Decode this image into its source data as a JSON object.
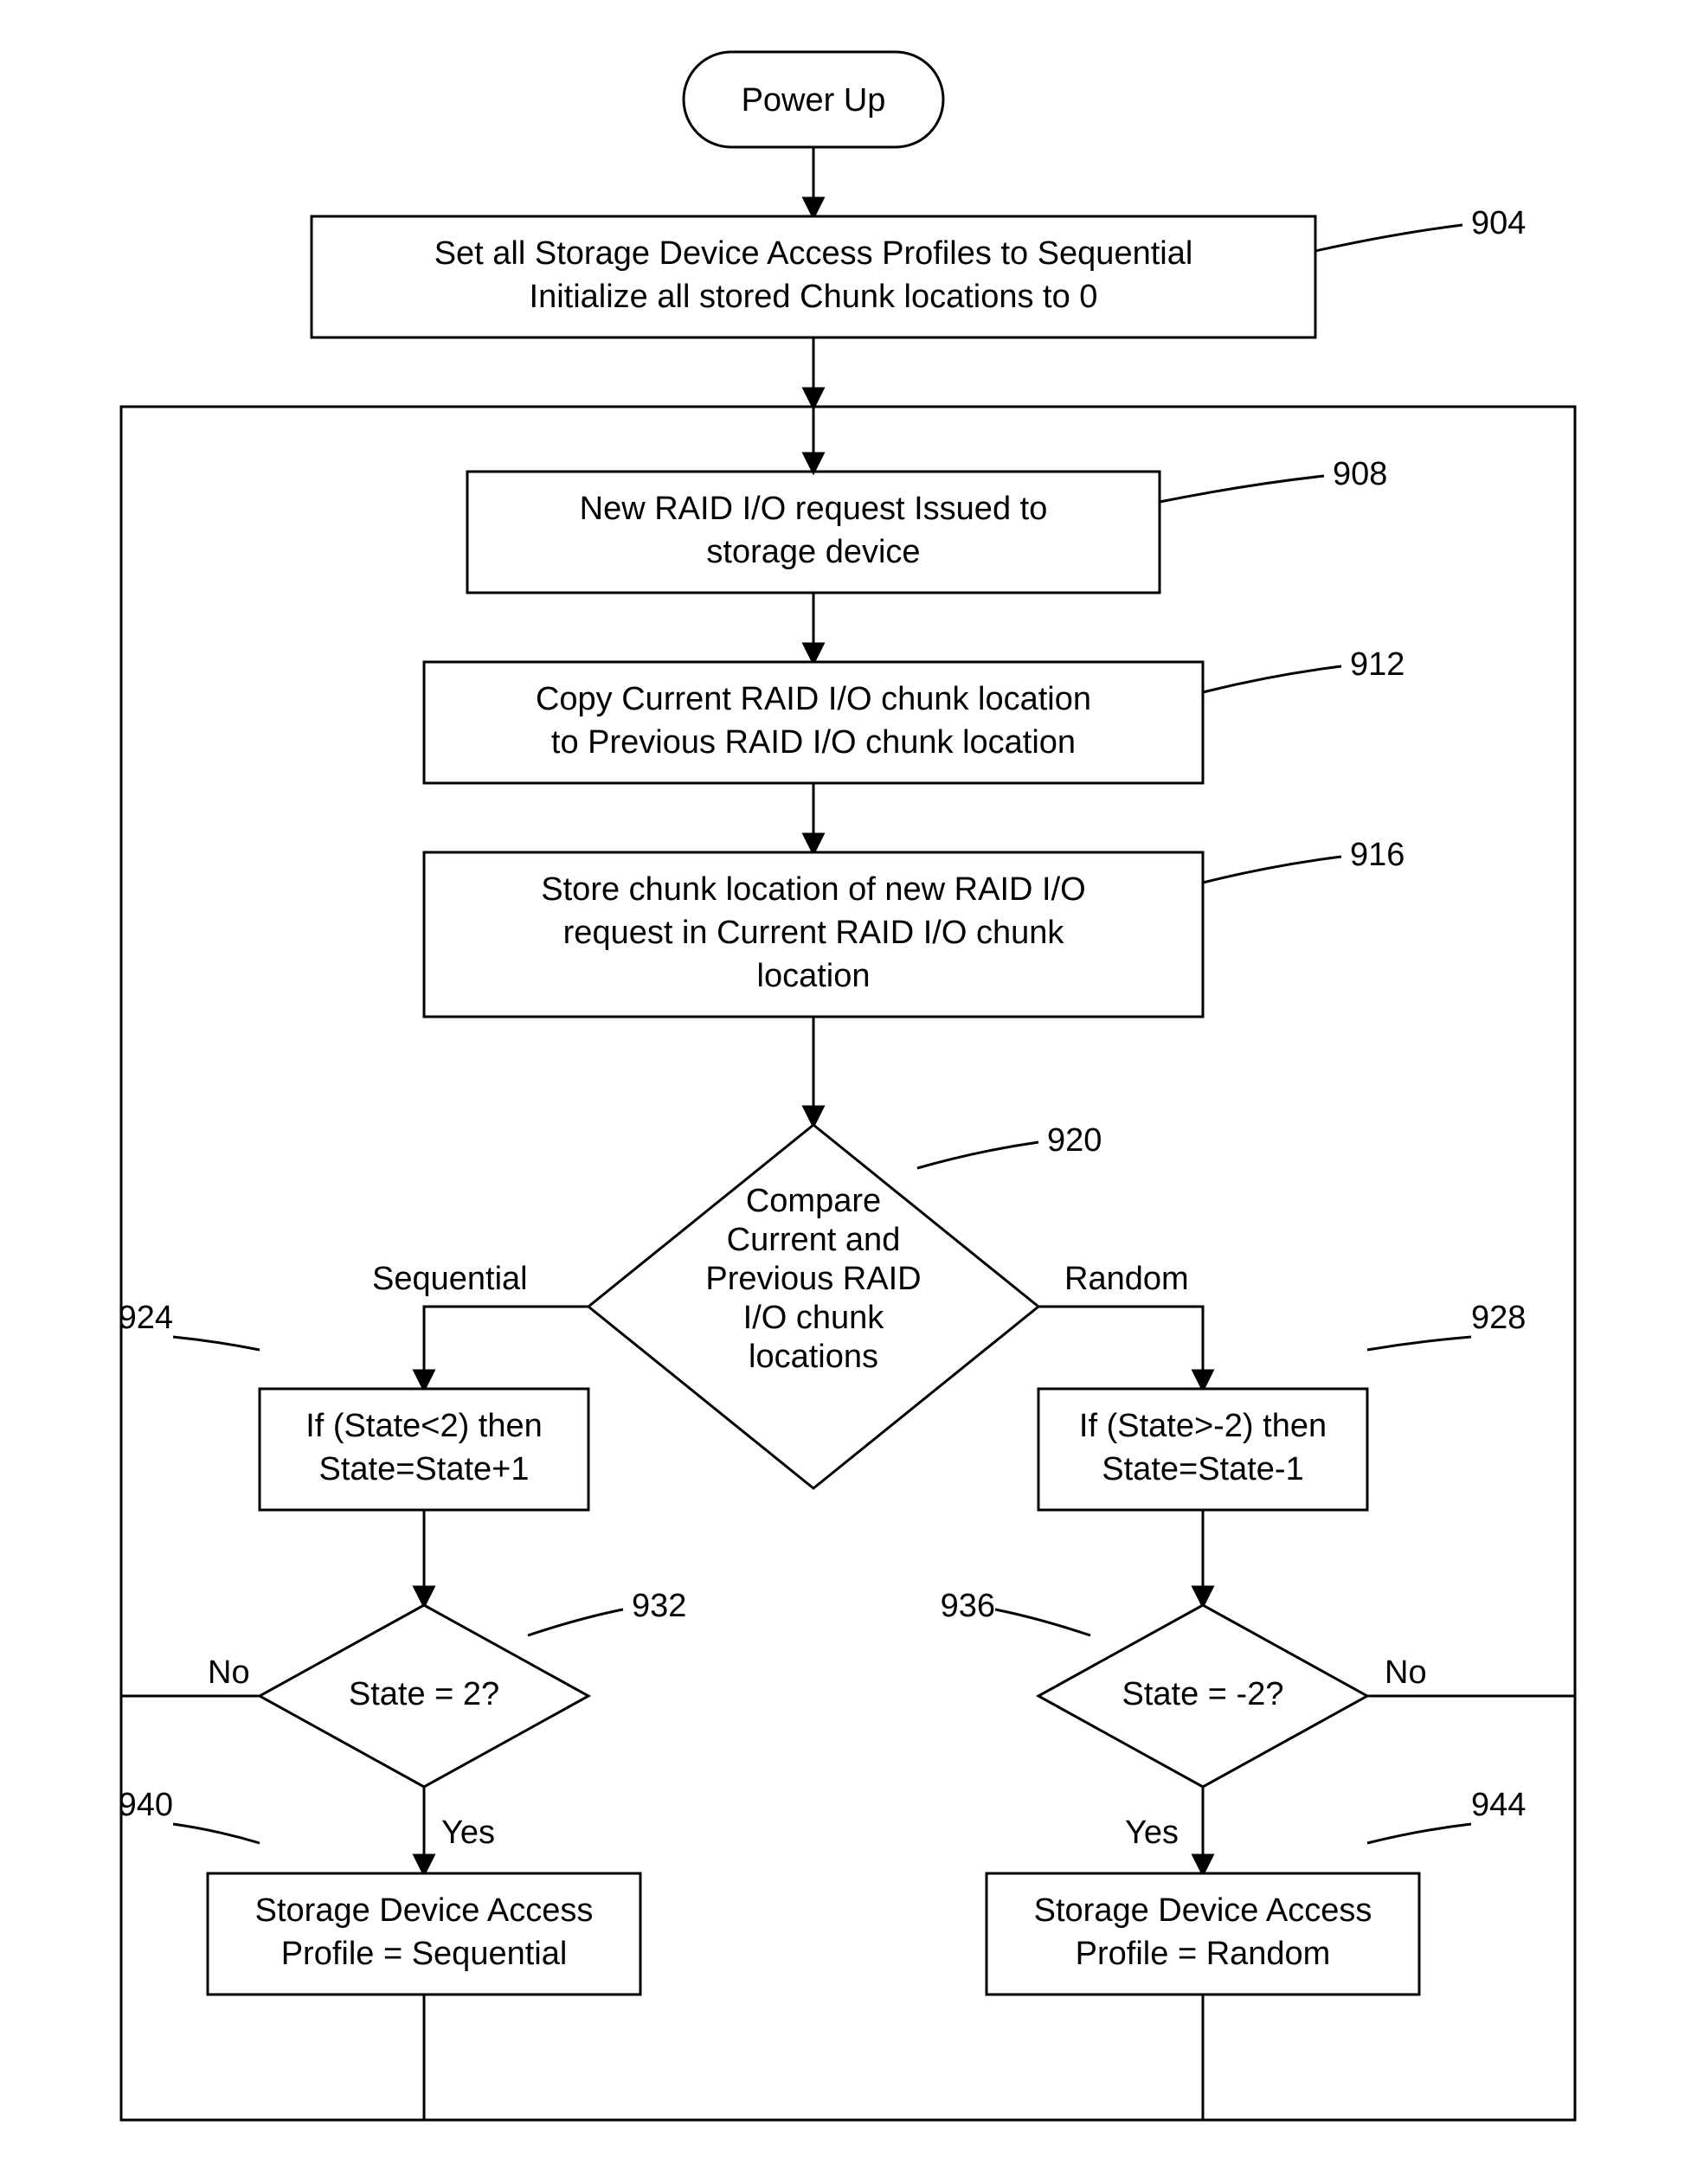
{
  "start": "Power Up",
  "n904": {
    "l1": "Set all Storage Device Access Profiles to Sequential",
    "l2": "Initialize all stored Chunk locations to 0",
    "ref": "904"
  },
  "n908": {
    "l1": "New RAID I/O request Issued to",
    "l2": "storage device",
    "ref": "908"
  },
  "n912": {
    "l1": "Copy Current RAID I/O chunk location",
    "l2": "to Previous RAID I/O chunk location",
    "ref": "912"
  },
  "n916": {
    "l1": "Store chunk location of new RAID I/O",
    "l2": "request in Current RAID I/O chunk",
    "l3": "location",
    "ref": "916"
  },
  "n920": {
    "l1": "Compare",
    "l2": "Current and",
    "l3": "Previous RAID",
    "l4": "I/O chunk",
    "l5": "locations",
    "ref": "920",
    "left": "Sequential",
    "right": "Random"
  },
  "n924": {
    "l1": "If (State<2) then",
    "l2": "State=State+1",
    "ref": "924"
  },
  "n928": {
    "l1": "If (State>-2) then",
    "l2": "State=State-1",
    "ref": "928"
  },
  "n932": {
    "l1": "State = 2?",
    "ref": "932",
    "yes": "Yes",
    "no": "No"
  },
  "n936": {
    "l1": "State = -2?",
    "ref": "936",
    "yes": "Yes",
    "no": "No"
  },
  "n940": {
    "l1": "Storage Device Access",
    "l2": "Profile = Sequential",
    "ref": "940"
  },
  "n944": {
    "l1": "Storage Device Access",
    "l2": "Profile = Random",
    "ref": "944"
  }
}
